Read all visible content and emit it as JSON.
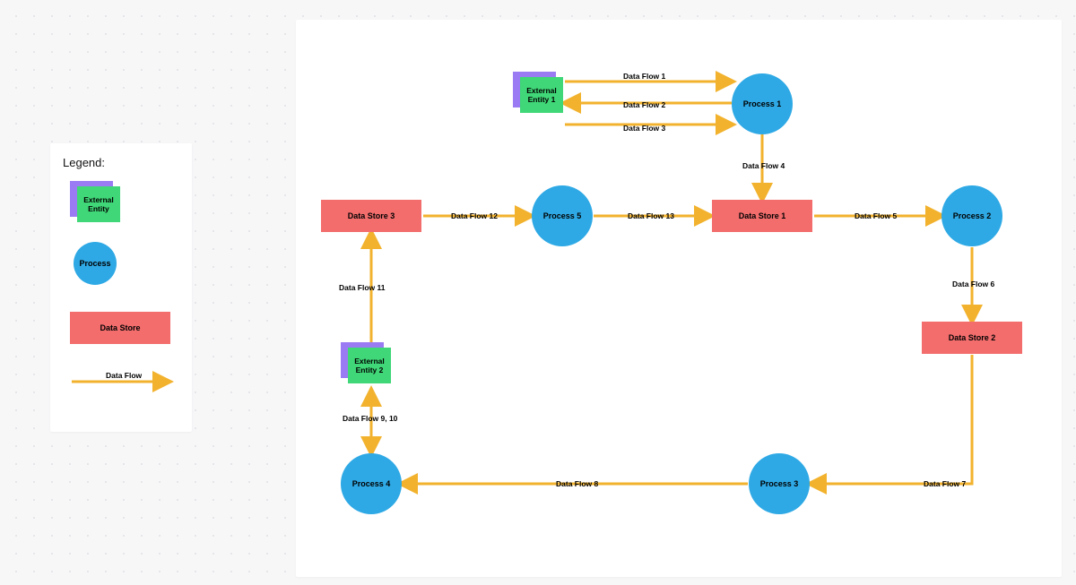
{
  "legend": {
    "title": "Legend:",
    "externalEntity": "External\nEntity",
    "process": "Process",
    "dataStore": "Data Store",
    "dataFlow": "Data Flow"
  },
  "nodes": {
    "extEntity1": "External\nEntity 1",
    "extEntity2": "External\nEntity 2",
    "process1": "Process 1",
    "process2": "Process 2",
    "process3": "Process 3",
    "process4": "Process 4",
    "process5": "Process 5",
    "dataStore1": "Data Store 1",
    "dataStore2": "Data Store 2",
    "dataStore3": "Data Store 3"
  },
  "flows": {
    "f1": "Data Flow 1",
    "f2": "Data Flow 2",
    "f3": "Data Flow 3",
    "f4": "Data Flow 4",
    "f5": "Data Flow 5",
    "f6": "Data Flow 6",
    "f7": "Data Flow 7",
    "f8": "Data Flow 8",
    "f9_10": "Data Flow 9, 10",
    "f11": "Data Flow 11",
    "f12": "Data Flow 12",
    "f13": "Data Flow 13"
  },
  "chart_data": {
    "type": "data-flow-diagram",
    "title": "",
    "entities": [
      {
        "id": "extEntity1",
        "kind": "external-entity",
        "label": "External Entity 1"
      },
      {
        "id": "extEntity2",
        "kind": "external-entity",
        "label": "External Entity 2"
      },
      {
        "id": "process1",
        "kind": "process",
        "label": "Process 1"
      },
      {
        "id": "process2",
        "kind": "process",
        "label": "Process 2"
      },
      {
        "id": "process3",
        "kind": "process",
        "label": "Process 3"
      },
      {
        "id": "process4",
        "kind": "process",
        "label": "Process 4"
      },
      {
        "id": "process5",
        "kind": "process",
        "label": "Process 5"
      },
      {
        "id": "dataStore1",
        "kind": "data-store",
        "label": "Data Store 1"
      },
      {
        "id": "dataStore2",
        "kind": "data-store",
        "label": "Data Store 2"
      },
      {
        "id": "dataStore3",
        "kind": "data-store",
        "label": "Data Store 3"
      }
    ],
    "flows": [
      {
        "id": "f1",
        "label": "Data Flow 1",
        "from": "extEntity1",
        "to": "process1"
      },
      {
        "id": "f2",
        "label": "Data Flow 2",
        "from": "process1",
        "to": "extEntity1"
      },
      {
        "id": "f3",
        "label": "Data Flow 3",
        "from": "extEntity1",
        "to": "process1"
      },
      {
        "id": "f4",
        "label": "Data Flow 4",
        "from": "process1",
        "to": "dataStore1"
      },
      {
        "id": "f5",
        "label": "Data Flow 5",
        "from": "dataStore1",
        "to": "process2"
      },
      {
        "id": "f6",
        "label": "Data Flow 6",
        "from": "process2",
        "to": "dataStore2"
      },
      {
        "id": "f7",
        "label": "Data Flow 7",
        "from": "dataStore2",
        "to": "process3"
      },
      {
        "id": "f8",
        "label": "Data Flow 8",
        "from": "process3",
        "to": "process4"
      },
      {
        "id": "f9",
        "label": "Data Flow 9",
        "from": "process4",
        "to": "extEntity2"
      },
      {
        "id": "f10",
        "label": "Data Flow 10",
        "from": "extEntity2",
        "to": "process4"
      },
      {
        "id": "f11",
        "label": "Data Flow 11",
        "from": "extEntity2",
        "to": "dataStore3"
      },
      {
        "id": "f12",
        "label": "Data Flow 12",
        "from": "dataStore3",
        "to": "process5"
      },
      {
        "id": "f13",
        "label": "Data Flow 13",
        "from": "process5",
        "to": "dataStore1"
      }
    ],
    "legend": [
      "External Entity",
      "Process",
      "Data Store",
      "Data Flow"
    ]
  }
}
